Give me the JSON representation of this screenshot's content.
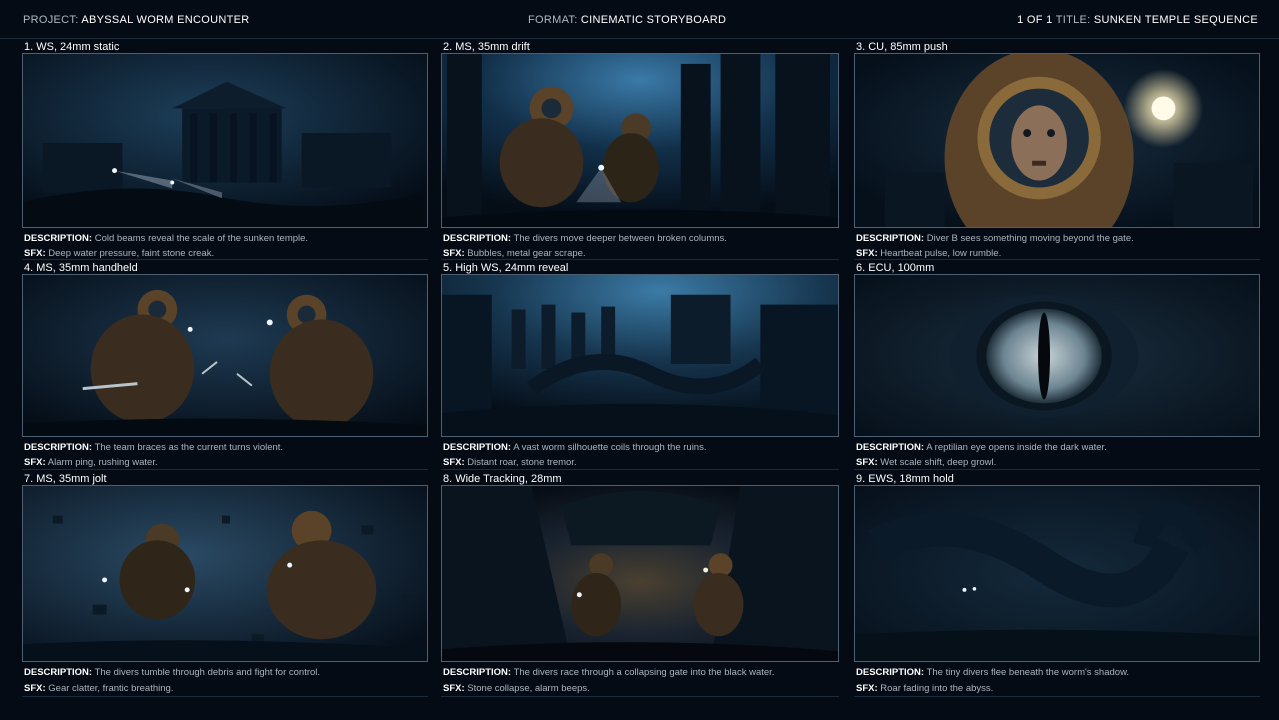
{
  "header": {
    "project_label": "PROJECT:",
    "project_value": "ABYSSAL WORM ENCOUNTER",
    "format_label": "FORMAT:",
    "format_value": "CINEMATIC STORYBOARD",
    "page": "1 OF 1",
    "title_label": "TITLE:",
    "title_value": "SUNKEN TEMPLE SEQUENCE"
  },
  "panels": [
    {
      "shot": "1. WS, 24mm static",
      "desc_label": "DESCRIPTION:",
      "desc": "Cold beams reveal the scale of the sunken temple.",
      "sfx_label": "SFX:",
      "sfx": "Deep water pressure, faint stone creak."
    },
    {
      "shot": "2. MS, 35mm drift",
      "desc_label": "DESCRIPTION:",
      "desc": "The divers move deeper between broken columns.",
      "sfx_label": "SFX:",
      "sfx": "Bubbles, metal gear scrape."
    },
    {
      "shot": "3. CU, 85mm push",
      "desc_label": "DESCRIPTION:",
      "desc": "Diver B sees something moving beyond the gate.",
      "sfx_label": "SFX:",
      "sfx": "Heartbeat pulse, low rumble."
    },
    {
      "shot": "4. MS, 35mm handheld",
      "desc_label": "DESCRIPTION:",
      "desc": "The team braces as the current turns violent.",
      "sfx_label": "SFX:",
      "sfx": "Alarm ping, rushing water."
    },
    {
      "shot": "5. High WS, 24mm reveal",
      "desc_label": "DESCRIPTION:",
      "desc": "A vast worm silhouette coils through the ruins.",
      "sfx_label": "SFX:",
      "sfx": "Distant roar, stone tremor."
    },
    {
      "shot": "6. ECU, 100mm",
      "desc_label": "DESCRIPTION:",
      "desc": "A reptilian eye opens inside the dark water.",
      "sfx_label": "SFX:",
      "sfx": "Wet scale shift, deep growl."
    },
    {
      "shot": "7. MS, 35mm jolt",
      "desc_label": "DESCRIPTION:",
      "desc": "The divers tumble through debris and fight for control.",
      "sfx_label": "SFX:",
      "sfx": "Gear clatter, frantic breathing."
    },
    {
      "shot": "8. Wide Tracking, 28mm",
      "desc_label": "DESCRIPTION:",
      "desc": "The divers race through a collapsing gate into the black water.",
      "sfx_label": "SFX:",
      "sfx": "Stone collapse, alarm beeps."
    },
    {
      "shot": "9. EWS, 18mm hold",
      "desc_label": "DESCRIPTION:",
      "desc": "The tiny divers flee beneath the worm's shadow.",
      "sfx_label": "SFX:",
      "sfx": "Roar fading into the abyss."
    }
  ],
  "colors": {
    "background": "#050b14",
    "frame_border": "#4c5f73",
    "water_deep": "#061220",
    "water_light": "#2a5a7c",
    "lamp": "#e8f2ff",
    "brass": "#8a6a3a"
  }
}
